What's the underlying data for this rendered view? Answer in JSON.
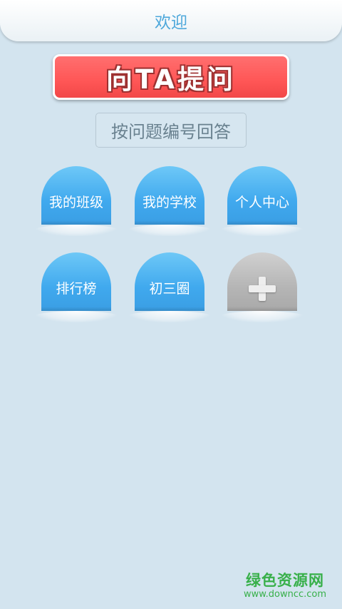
{
  "header": {
    "title": "欢迎"
  },
  "actions": {
    "ask_label": "向TA提问",
    "answer_by_number_label": "按问题编号回答"
  },
  "grid": {
    "items": [
      {
        "label": "我的班级"
      },
      {
        "label": "我的学校"
      },
      {
        "label": "个人中心"
      },
      {
        "label": "排行榜"
      },
      {
        "label": "初三圈"
      }
    ],
    "add_icon": "plus-icon"
  },
  "watermark": {
    "title": "绿色资源网",
    "url": "www.downcc.com"
  },
  "colors": {
    "background": "#d3e4ef",
    "title": "#4ea8db",
    "ask_button": "#ff5a5a",
    "circle_blue": "#40a9ee",
    "circle_gray": "#b5b5b5",
    "watermark": "#38b04a"
  }
}
